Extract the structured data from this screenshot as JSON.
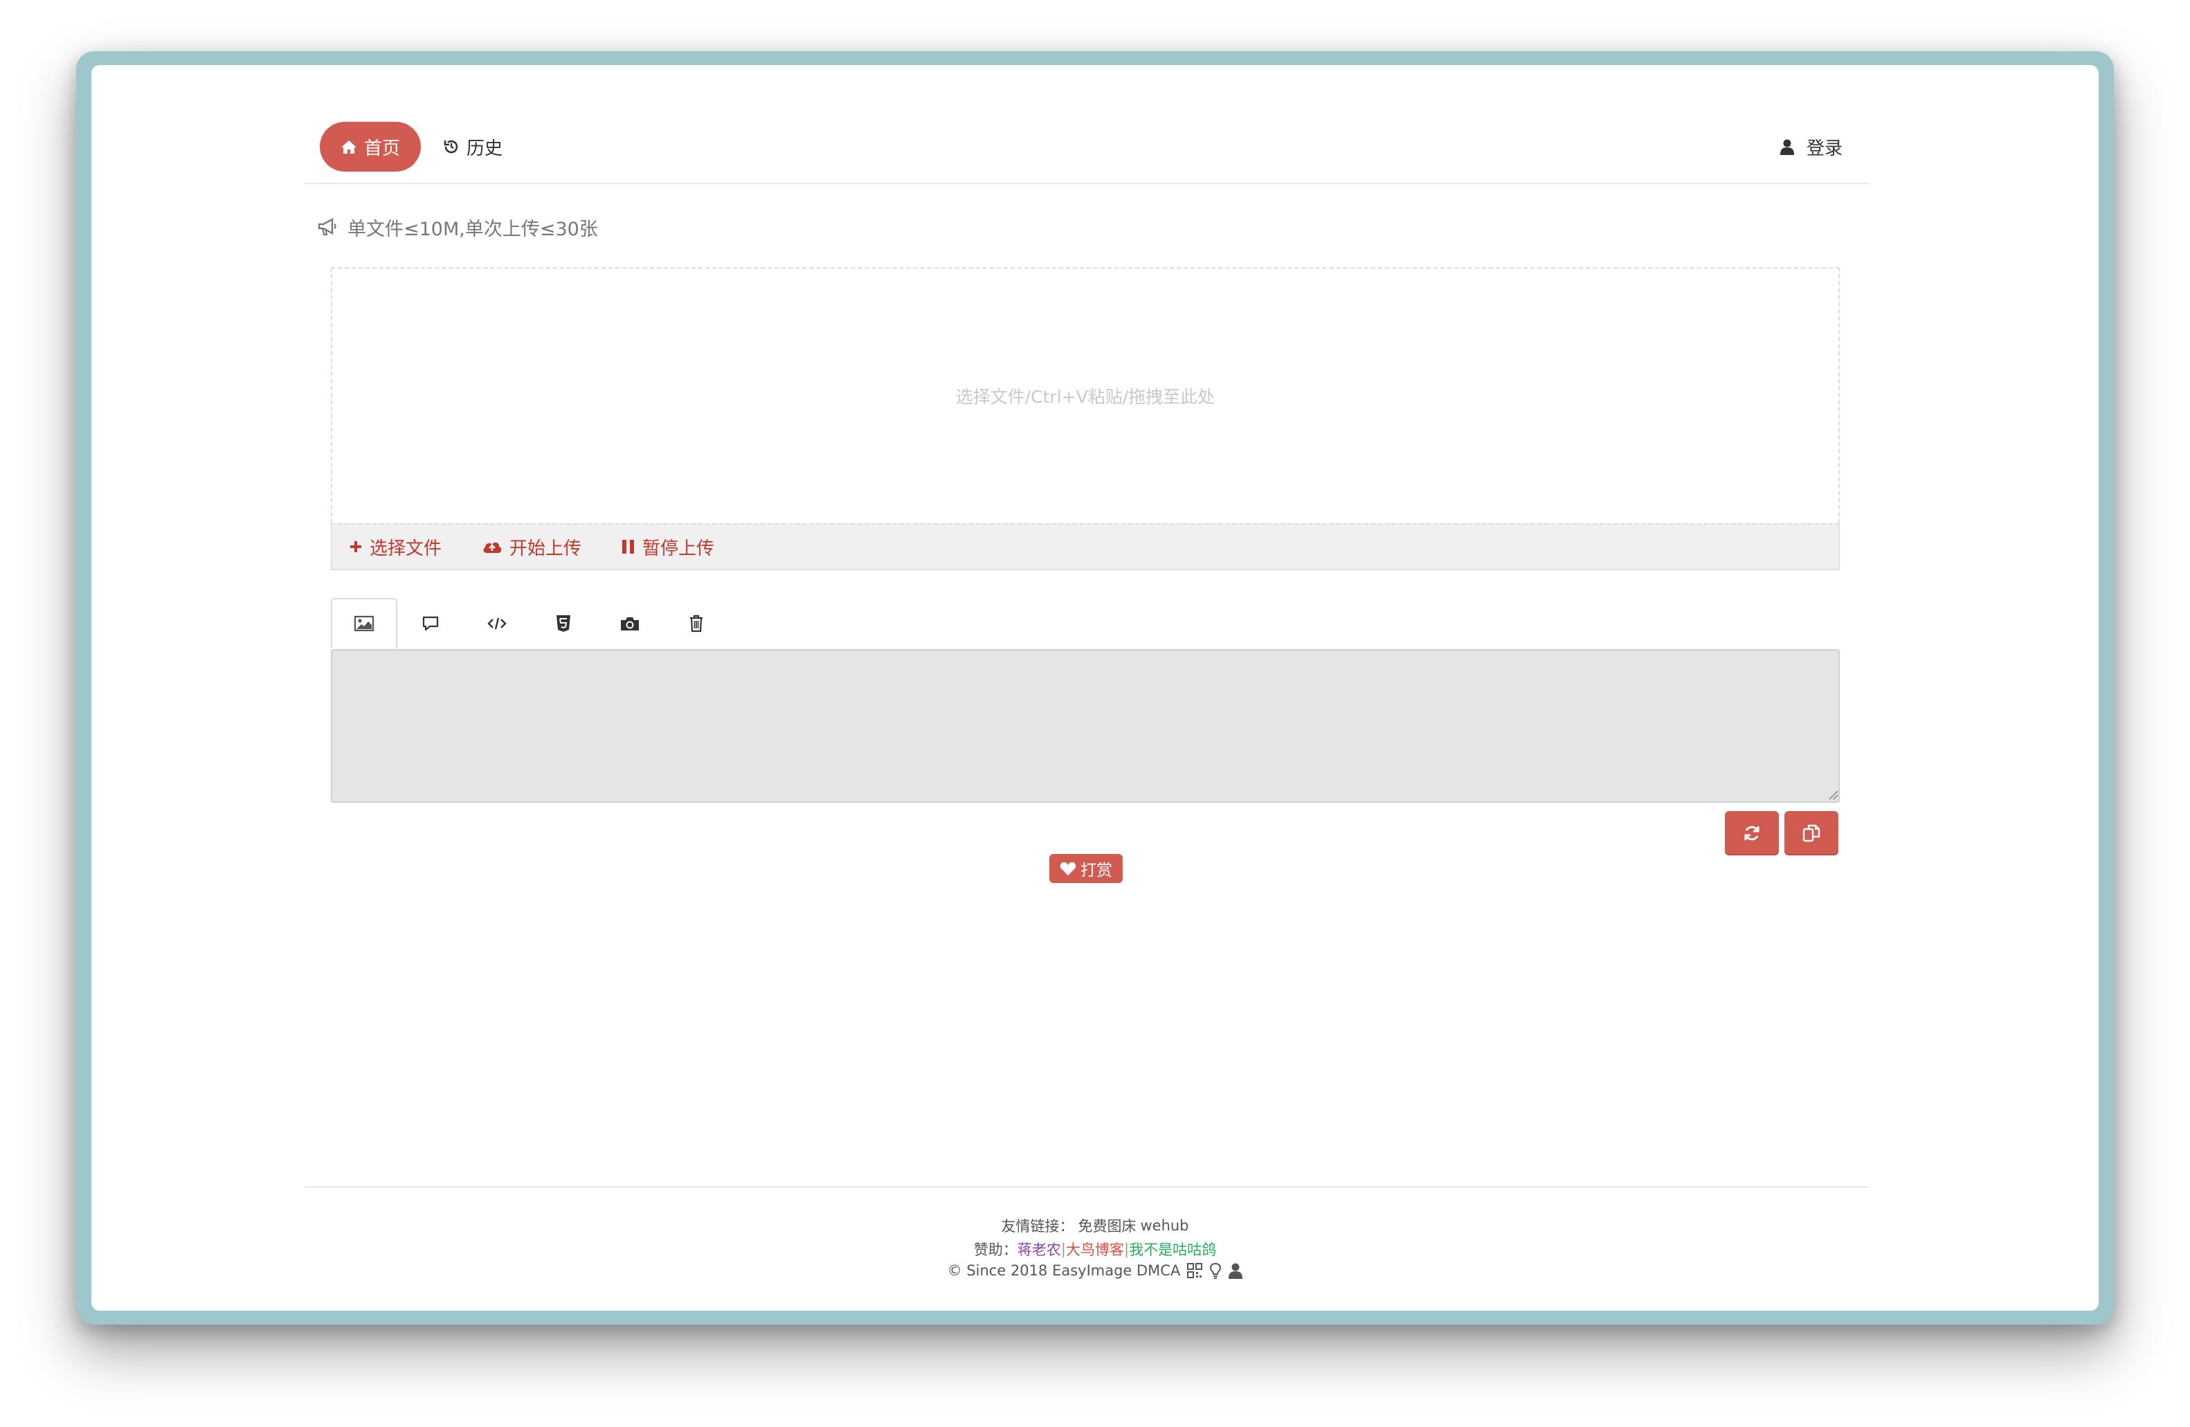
{
  "nav": {
    "home_label": "首页",
    "history_label": "历史",
    "login_label": "登录"
  },
  "notice": {
    "text": "单文件≤10M,单次上传≤30张"
  },
  "upload": {
    "hint": "选择文件/Ctrl+V粘贴/拖拽至此处",
    "choose_label": "选择文件",
    "start_label": "开始上传",
    "pause_label": "暂停上传"
  },
  "tabs": [
    {
      "icon": "image-icon"
    },
    {
      "icon": "comment-icon"
    },
    {
      "icon": "code-icon"
    },
    {
      "icon": "html5-icon"
    },
    {
      "icon": "camera-icon"
    },
    {
      "icon": "trash-icon"
    }
  ],
  "output": {
    "value": ""
  },
  "actions": {
    "refresh_icon": "refresh-icon",
    "copy_icon": "copy-icon",
    "reward_label": "打赏"
  },
  "footer": {
    "links_prefix": "友情链接：",
    "link1": "免费图床",
    "link2": "wehub",
    "sponsor_prefix": "赞助：",
    "sponsor1": "蒋老农",
    "sponsor2": "大鸟博客",
    "sponsor3": "我不是咕咕鸽",
    "separator": "|",
    "copyright": "© Since 2018 EasyImage DMCA"
  },
  "colors": {
    "accent": "#d15b50",
    "frame": "#9ec7cb"
  }
}
